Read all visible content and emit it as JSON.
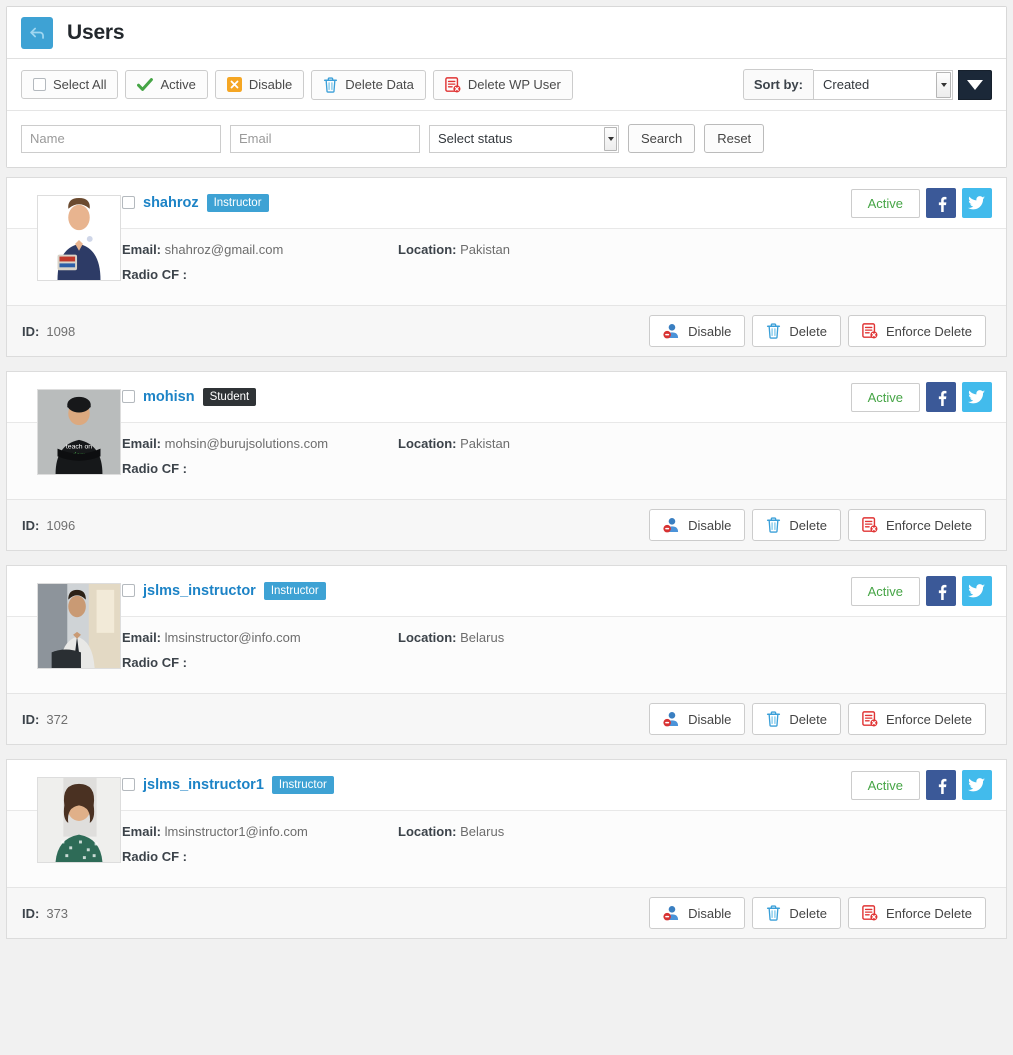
{
  "header": {
    "title": "Users",
    "back_icon": "back-arrow-icon"
  },
  "toolbar": {
    "select_all": "Select All",
    "active": "Active",
    "disable": "Disable",
    "delete_data": "Delete Data",
    "delete_wp_user": "Delete WP User",
    "sort_by_label": "Sort by:",
    "sort_by_value": "Created",
    "sort_by_options": [
      "Created"
    ],
    "sort_direction_icon": "triangle-down-icon"
  },
  "filters": {
    "name_placeholder": "Name",
    "name_value": "",
    "email_placeholder": "Email",
    "email_value": "",
    "status_value": "Select status",
    "status_options": [
      "Select status"
    ],
    "search": "Search",
    "reset": "Reset"
  },
  "labels": {
    "email": "Email:",
    "location": "Location:",
    "radio_cf": "Radio CF :",
    "id": "ID:",
    "active": "Active",
    "disable": "Disable",
    "delete": "Delete",
    "enforce_delete": "Enforce Delete"
  },
  "colors": {
    "accent_blue": "#3ea2d4",
    "link_blue": "#1c83c6",
    "badge_student": "#2f3336",
    "active_green": "#46a546",
    "facebook": "#3b5998",
    "twitter": "#42bbec",
    "sort_dir_bg": "#1b2838",
    "disable_orange": "#f0a020",
    "delete_red": "#e02b2b"
  },
  "users": [
    {
      "username": "shahroz",
      "role": "Instructor",
      "role_type": "instructor",
      "email": "shahroz@gmail.com",
      "location": "Pakistan",
      "radio_cf": "",
      "id": "1098",
      "status": "Active",
      "avatar": "male-polo-shirt-photo"
    },
    {
      "username": "mohisn",
      "role": "Student",
      "role_type": "student",
      "email": "mohsin@burujsolutions.com",
      "location": "Pakistan",
      "radio_cf": "",
      "id": "1096",
      "status": "Active",
      "avatar": "male-cap-black-tshirt-photo"
    },
    {
      "username": "jslms_instructor",
      "role": "Instructor",
      "role_type": "instructor",
      "email": "lmsinstructor@info.com",
      "location": "Belarus",
      "radio_cf": "",
      "id": "372",
      "status": "Active",
      "avatar": "man-suit-window-photo"
    },
    {
      "username": "jslms_instructor1",
      "role": "Instructor",
      "role_type": "instructor",
      "email": "lmsinstructor1@info.com",
      "location": "Belarus",
      "radio_cf": "",
      "id": "373",
      "status": "Active",
      "avatar": "woman-curly-hair-photo"
    }
  ]
}
